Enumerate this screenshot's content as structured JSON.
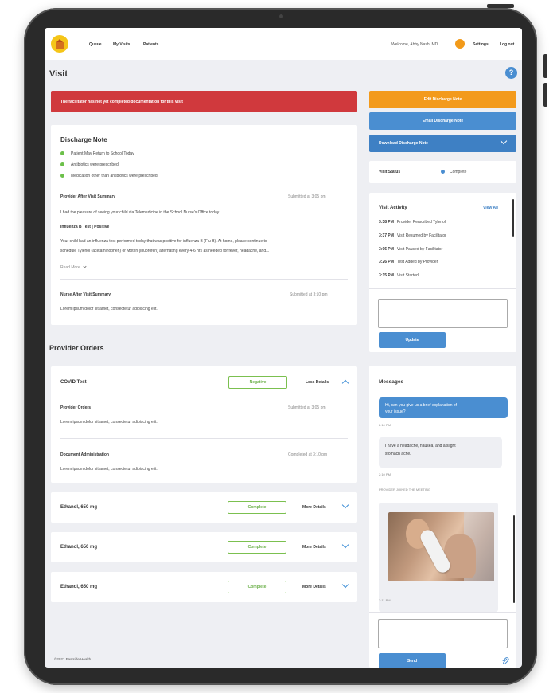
{
  "colors": {
    "alert": "#d0393d",
    "orange": "#f39a1c",
    "primary": "#4a8ed1",
    "complete_green": "#6cb04a",
    "tablet_frame": "#2a2a2a",
    "screen_bg": "#eeeff3"
  },
  "nav": {
    "links": [
      "Queue",
      "My Visits",
      "Patients"
    ],
    "welcome": "Welcome, Abby Nash, MD",
    "settings": "Settings",
    "logout": "Log out"
  },
  "page": {
    "title": "Visit",
    "help_icon": "?"
  },
  "alert": {
    "text": "The facilitator has not yet completed documentation for this visit"
  },
  "discharge_note": {
    "title": "Discharge Note",
    "bullets": [
      "Patient May Return to School Today",
      "Antibiotics were prescribed",
      "Medication other than antibiotics were prescribed"
    ],
    "provider_summary": {
      "title": "Provider After Visit Summary",
      "submitted": "Submitted at 3:05 pm",
      "intro": "I had the pleasure of seeing your child via Telemedicine in the School Nurse's Office today.",
      "subtitle": "Influenza B Test | Positive",
      "body_line1": "Your child had an influenza test performed today that was positive for influenza B (Flu B). At home, please continue to",
      "body_line2": "schedule Tylenol (acetaminophen) or Motrin (ibuprofen) alternating every 4-6 hrs as needed for fever, headache, and...",
      "read_more": "Read More"
    },
    "nurse_summary": {
      "title": "Nurse After Visit Summary",
      "submitted": "Submitted at 3:10 pm",
      "body": "Lorem ipsum dolor sit amet, consectetur adipiscing elit."
    }
  },
  "provider_orders": {
    "title": "Provider Orders",
    "covid": {
      "name": "COVID Test",
      "status": "Negative",
      "toggle": "Less Details",
      "sub1_title": "Provider Orders",
      "sub1_meta": "Submitted at 3:05 pm",
      "sub1_body": "Lorem ipsum dolor sit amet, consectetur adipiscing elit.",
      "sub2_title": "Document Administration",
      "sub2_meta": "Completed at 3:10 pm",
      "sub2_body": "Lorem ipsum dolor sit amet, consectetur adipiscing elit."
    },
    "orders": [
      {
        "name": "Ethanol, 650 mg",
        "status": "Complete",
        "toggle": "More Details"
      },
      {
        "name": "Ethanol, 650 mg",
        "status": "Complete",
        "toggle": "More Details"
      },
      {
        "name": "Ethanol, 650 mg",
        "status": "Complete",
        "toggle": "More Details"
      }
    ]
  },
  "footer": "©2021 Eastside Health",
  "actions": {
    "edit": "Edit Discharge Note",
    "email": "Email Discharge Note",
    "download": "Download Discharge Note"
  },
  "visit_status": {
    "label": "Visit Status",
    "value": "Complete"
  },
  "activity": {
    "title": "Visit Activity",
    "view_all": "View All",
    "items": [
      {
        "time": "3:38 PM",
        "text": "Provider Perscribed Tylenol"
      },
      {
        "time": "3:37 PM",
        "text": "Visit Resumed by Facilitator"
      },
      {
        "time": "3:06 PM",
        "text": "Visit Paused by Facilitator"
      },
      {
        "time": "3:26 PM",
        "text": "Test Added by Provider"
      },
      {
        "time": "3:15 PM",
        "text": "Visit Started"
      }
    ],
    "update_button": "Update"
  },
  "messages": {
    "title": "Messages",
    "outgoing_line1": "Hi, can you give us a brief explanation of",
    "outgoing_line2": "your issue?",
    "outgoing_time": "2:10 PM",
    "incoming_line1": "I have a headache, nausea, and a slight",
    "incoming_line2": "stomach ache.",
    "incoming_time": "2:10 PM",
    "system": "PROVIDER JOINED THE MEETING",
    "photo_time": "2:11 PM",
    "send_button": "Send"
  }
}
